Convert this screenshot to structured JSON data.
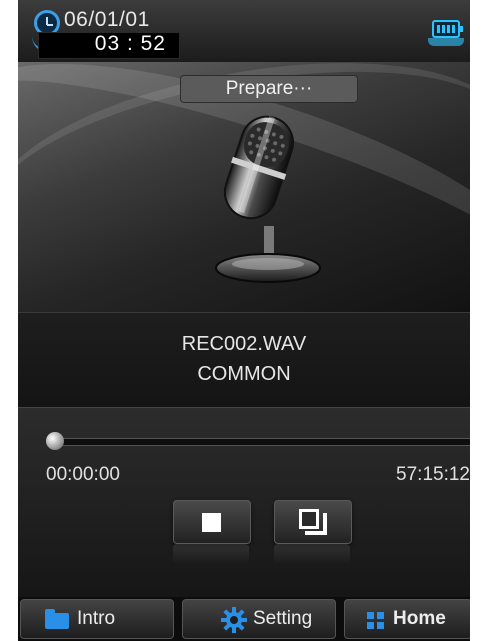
{
  "status_bar": {
    "date": "06/01/01",
    "time": "03 : 52",
    "clock_icon": "clock-icon",
    "battery_icon": "battery-icon"
  },
  "recorder": {
    "status": "Prepare···",
    "image_icon": "microphone-icon",
    "file_name": "REC002.WAV",
    "category": "COMMON"
  },
  "progress": {
    "elapsed": "00:00:00",
    "remaining": "57:15:12",
    "position_fraction": 0
  },
  "controls": {
    "stop_icon": "stop-icon",
    "save_icon": "save-icon"
  },
  "nav": {
    "intro_label": "Intro",
    "setting_label": "Setting",
    "home_label": "Home",
    "intro_icon": "folder-icon",
    "setting_icon": "gear-icon",
    "home_icon": "grid-icon"
  },
  "colors": {
    "accent": "#2a8fe6",
    "battery": "#2ec2ff"
  }
}
